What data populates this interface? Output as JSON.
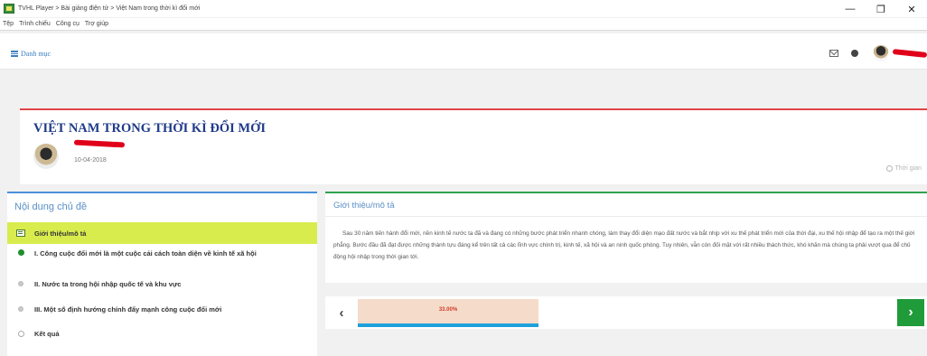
{
  "window": {
    "title": "TVHL Player > Bài giảng điện tử > Việt Nam trong thời kì đổi mới",
    "controls": {
      "minimize": "—",
      "maximize": "❐",
      "close": "✕"
    }
  },
  "menu": [
    "Tệp",
    "Trình chiếu",
    "Công cụ",
    "Trợ giúp"
  ],
  "topnav": {
    "danh_muc": "Danh mục"
  },
  "lesson": {
    "title": "VIỆT NAM TRONG THỜI KÌ ĐỔI MỚI",
    "date": "10-04-2018",
    "time_label": "Thời gian"
  },
  "topics": {
    "heading": "Nội dung chủ đề",
    "items": [
      {
        "label": "Giới thiệu/mô tả",
        "icon": "list-icon"
      },
      {
        "label": "I. Công cuộc đổi mới là một cuộc cải cách toàn diện về kinh tế xã hội",
        "icon": "green-dot-icon"
      },
      {
        "label": "II. Nước ta trong hội nhập quốc tế và khu vực",
        "icon": "gray-dot-icon"
      },
      {
        "label": "III. Một số định hướng chính đẩy mạnh công cuộc đổi mới",
        "icon": "gray-dot-icon"
      },
      {
        "label": "Kết quả",
        "icon": "circle-icon"
      }
    ]
  },
  "intro": {
    "heading": "Giới thiệu/mô tả",
    "text": "Sau 30 năm tiến hành đổi mới, nền kinh tế nước ta đã và đang có những bước phát triển nhanh chóng, làm thay đổi diện mạo đất nước và bắt nhịp với xu thế phát triển mới của thời đại, xu thế hội nhập để tạo ra một thế giới phẳng. Bước đầu đã đạt được những thành tựu đáng kể trên tất cả các lĩnh vực chính trị, kinh tế, xã hội và an ninh quốc phòng. Tuy nhiên, vẫn còn đối mặt với rất nhiều thách thức, khó khăn mà chúng ta phải vượt qua để chủ động hội nhập trong thời gian tới."
  },
  "nav": {
    "prev": "‹",
    "next": "›",
    "progress_label": "33.00%",
    "progress_fill": 1.0
  },
  "colors": {
    "accent_red": "#e0444a",
    "accent_blue": "#4a90d9",
    "accent_green": "#2ea44f",
    "active_topic": "#d8ec4e",
    "next_button": "#1f9b3a"
  }
}
